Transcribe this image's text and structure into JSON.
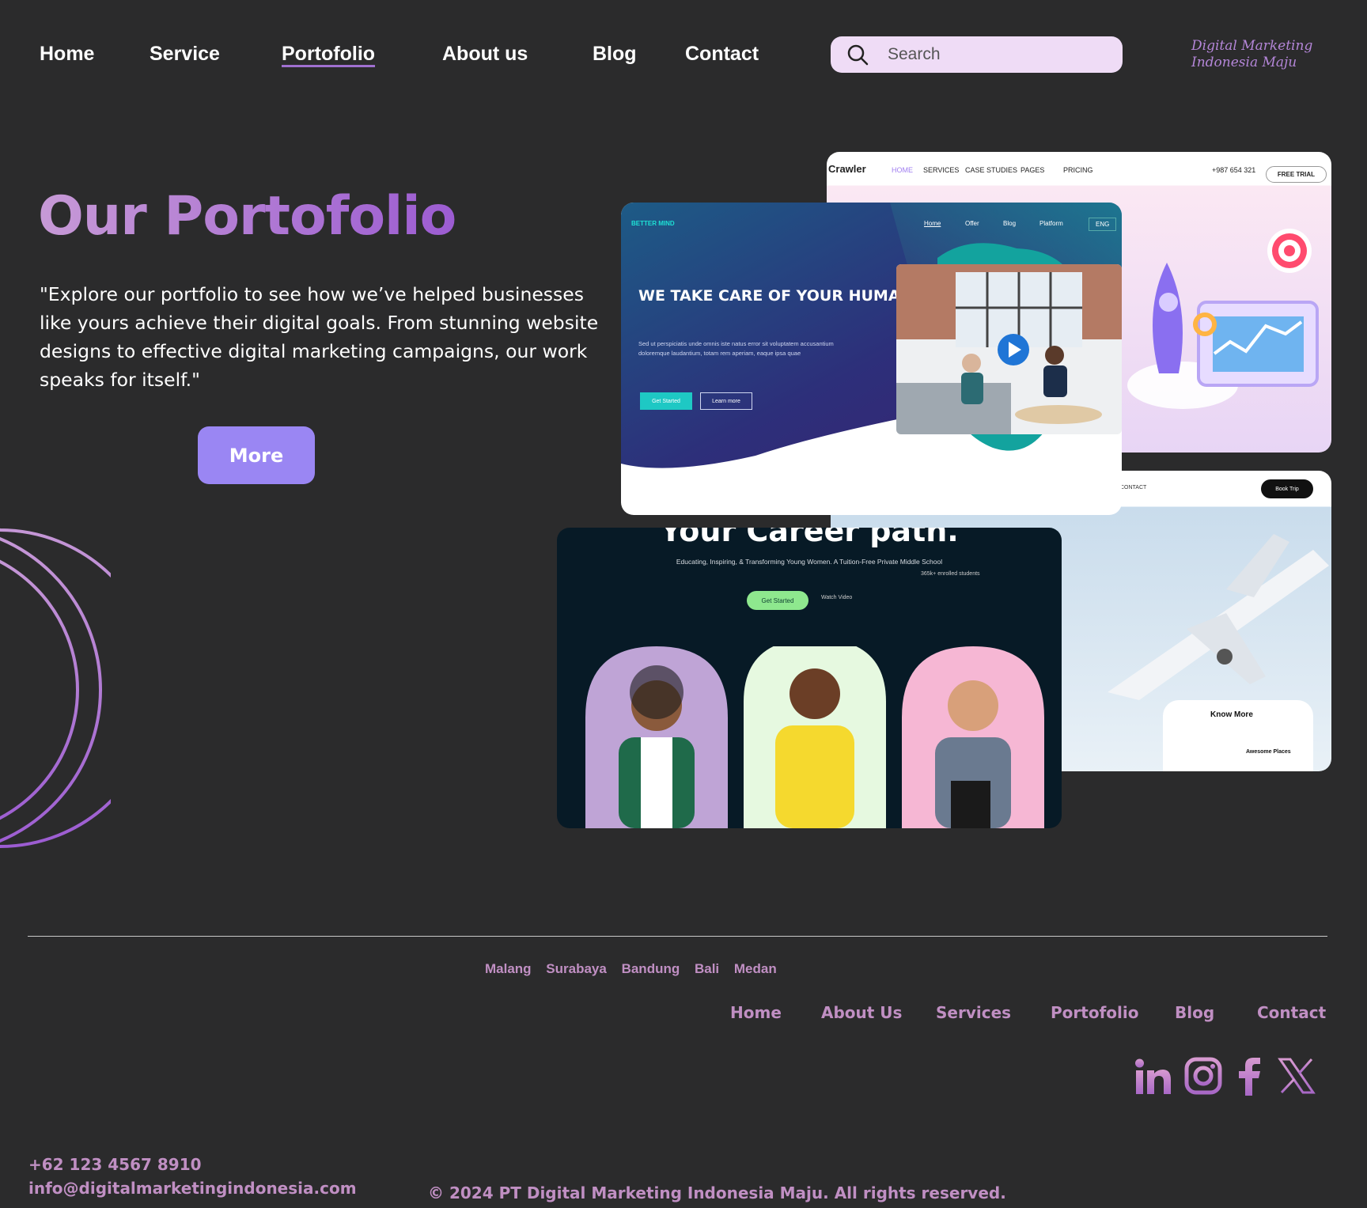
{
  "nav": {
    "items": [
      "Home",
      "Service",
      "Portofolio",
      "About us",
      "Blog",
      "Contact"
    ],
    "active": "Portofolio"
  },
  "search": {
    "placeholder": "Search"
  },
  "logo": {
    "line1": "Digital Marketing",
    "line2": "Indonesia Maju"
  },
  "hero": {
    "title": "Our Portofolio",
    "description": "\"Explore our portfolio to see how we’ve helped businesses like yours achieve their digital goals. From stunning website designs to effective digital marketing campaigns, our work speaks for itself.\"",
    "more_label": "More"
  },
  "mockups": {
    "crawler": {
      "brand": "Crawler",
      "links": [
        "HOME",
        "SERVICES",
        "CASE STUDIES",
        "PAGES",
        "PRICING"
      ],
      "phone": "+987 654 321",
      "cta": "FREE TRIAL"
    },
    "better_mind": {
      "brand": "BETTER MIND",
      "links": [
        "Home",
        "Offer",
        "Blog",
        "Platform"
      ],
      "lang": "ENG",
      "headline": "WE TAKE CARE OF YOUR HUMAN CAPITAL",
      "sub": "Sed ut perspiciatis unde omnis iste natus error sit voluptatem accusantium doloremque laudantium, totam rem aperiam, eaque ipsa quae",
      "primary": "Get Started",
      "secondary": "Learn more"
    },
    "career": {
      "headline": "Your Career path.",
      "sub": "Educating, Inspiring, & Transforming Young Women. A Tuition-Free Private Middle School",
      "enrolled": "365k+ enrolled students",
      "primary": "Get Started",
      "secondary": "Watch Video"
    },
    "travel": {
      "contact": "CONTACT",
      "cta": "Book Trip",
      "know_more": "Know More",
      "places": "Awesome Places"
    }
  },
  "footer": {
    "cities": [
      "Malang",
      "Surabaya",
      "Bandung",
      "Bali",
      "Medan"
    ],
    "links": [
      "Home",
      "About Us",
      "Services",
      "Portofolio",
      "Blog",
      "Contact"
    ],
    "social": [
      "linkedin-icon",
      "instagram-icon",
      "facebook-icon",
      "x-icon"
    ],
    "phone": "+62 123 4567 8910",
    "email": "info@digitalmarketingindonesia.com",
    "copyright": "© 2024 PT Digital Marketing Indonesia Maju. All rights reserved."
  },
  "colors": {
    "background": "#2b2b2c",
    "accent": "#9a86f3",
    "footer_text": "#c08fc3",
    "search_bg": "#efdcf6"
  }
}
